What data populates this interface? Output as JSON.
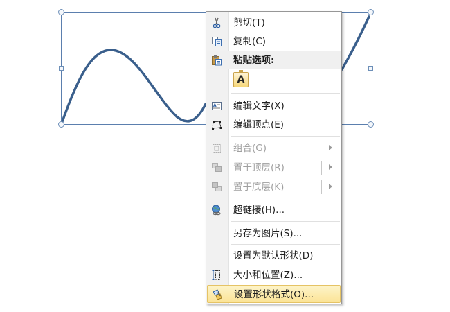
{
  "context_menu": {
    "items": [
      {
        "label": "剪切(T)",
        "icon": "scissors-icon",
        "enabled": true
      },
      {
        "label": "复制(C)",
        "icon": "copy-icon",
        "enabled": true
      },
      {
        "label": "粘贴选项:",
        "icon": "paste-icon",
        "enabled": true,
        "header": true
      },
      {
        "label": "编辑文字(X)",
        "icon": "edit-text-icon",
        "enabled": true
      },
      {
        "label": "编辑顶点(E)",
        "icon": "edit-points-icon",
        "enabled": true
      },
      {
        "label": "组合(G)",
        "icon": "group-icon",
        "enabled": false,
        "submenu": true
      },
      {
        "label": "置于顶层(R)",
        "icon": "bring-to-front-icon",
        "enabled": false,
        "submenu": true
      },
      {
        "label": "置于底层(K)",
        "icon": "send-to-back-icon",
        "enabled": false,
        "submenu": true
      },
      {
        "label": "超链接(H)...",
        "icon": "hyperlink-icon",
        "enabled": true
      },
      {
        "label": "另存为图片(S)...",
        "icon": "",
        "enabled": true
      },
      {
        "label": "设置为默认形状(D)",
        "icon": "",
        "enabled": true
      },
      {
        "label": "大小和位置(Z)...",
        "icon": "size-position-icon",
        "enabled": true
      },
      {
        "label": "设置形状格式(O)...",
        "icon": "format-shape-icon",
        "enabled": true,
        "highlighted": true
      }
    ],
    "paste_option_label": "A"
  },
  "colors": {
    "curve": "#3a5f8c",
    "selection_border": "#5b7fae",
    "menu_highlight": "#fbe396",
    "disabled_text": "#a0a0a0"
  }
}
